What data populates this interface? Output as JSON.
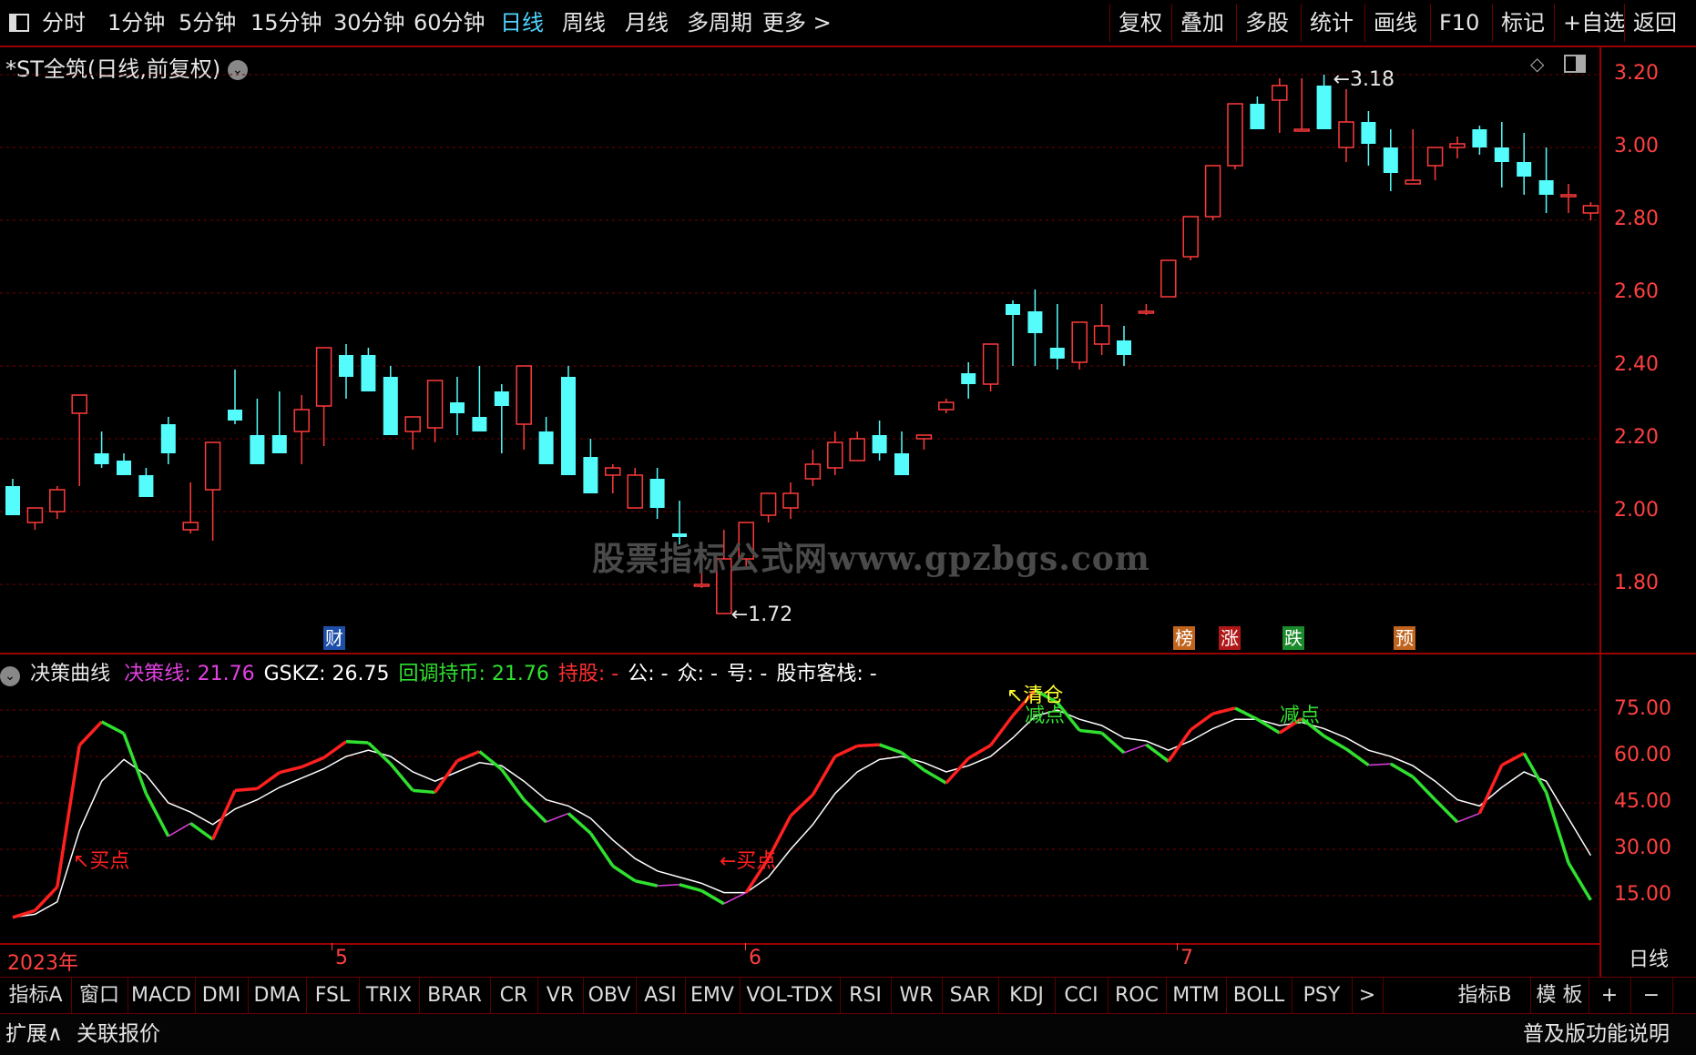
{
  "topbar": {
    "icon": "panel-toggle-icon",
    "periods": [
      "分时",
      "1分钟",
      "5分钟",
      "15分钟",
      "30分钟",
      "60分钟",
      "日线",
      "周线",
      "月线",
      "多周期",
      "更多 >"
    ],
    "selected": "日线",
    "tools": [
      "复权",
      "叠加",
      "多股",
      "统计",
      "画线",
      "F10",
      "标记",
      "+自选",
      "返回"
    ]
  },
  "main_chart": {
    "title": "*ST全筑(日线,前复权)",
    "high_label": "3.18",
    "low_label": "1.72",
    "watermark": "股票指标公式网www.gpzbgs.com",
    "y_ticks": [
      "3.20",
      "3.00",
      "2.80",
      "2.60",
      "2.40",
      "2.20",
      "2.00",
      "1.80"
    ],
    "event_tags": [
      {
        "text": "财",
        "color": "#1e4fa8"
      },
      {
        "text": "榜",
        "color": "#c0641e"
      },
      {
        "text": "涨",
        "color": "#b01818"
      },
      {
        "text": "跌",
        "color": "#1a8a2a"
      },
      {
        "text": "预",
        "color": "#c0641e"
      }
    ]
  },
  "indicator": {
    "name": "决策曲线",
    "legend": [
      {
        "label": "决策线: 21.76",
        "color": "#e040e0"
      },
      {
        "label": "GSKZ: 26.75",
        "color": "#ffffff"
      },
      {
        "label": "回调持币: 21.76",
        "color": "#30e030"
      },
      {
        "label": "持股: -",
        "color": "#ff3030"
      },
      {
        "label": "公: -",
        "color": "#ffffff"
      },
      {
        "label": "众: -",
        "color": "#ffffff"
      },
      {
        "label": "号: -",
        "color": "#ffffff"
      },
      {
        "label": "股市客栈: -",
        "color": "#ffffff"
      }
    ],
    "y_ticks": [
      "75.00",
      "60.00",
      "45.00",
      "30.00",
      "15.00"
    ],
    "signals": {
      "buy1": "↖买点",
      "buy2": "←买点",
      "clear": "↖清仓",
      "reduce1": "减点",
      "reduce2": "减点"
    }
  },
  "x_axis": {
    "labels": [
      "2023年",
      "5",
      "6",
      "7"
    ],
    "period": "日线"
  },
  "chart_data": {
    "type": "candlestick",
    "ohlc_open": [
      2.07,
      1.97,
      2.0,
      2.27,
      2.16,
      2.14,
      2.1,
      2.24,
      1.95,
      2.06,
      2.28,
      2.21,
      2.21,
      2.22,
      2.29,
      2.43,
      2.43,
      2.37,
      2.22,
      2.23,
      2.3,
      2.26,
      2.33,
      2.24,
      2.22,
      2.37,
      2.15,
      2.1,
      2.01,
      2.09,
      1.94,
      1.8,
      1.72,
      1.87,
      1.99,
      2.01,
      2.09,
      2.12,
      2.14,
      2.21,
      2.16,
      2.2,
      2.28,
      2.38,
      2.35,
      2.57,
      2.55,
      2.45,
      2.41,
      2.46,
      2.47,
      2.55,
      2.59,
      2.7,
      2.81,
      2.95,
      3.12,
      3.13,
      3.05,
      3.17,
      3.0,
      3.07,
      3.0,
      2.9,
      2.95,
      3.0,
      3.05,
      3.0,
      2.96,
      2.91,
      2.87,
      2.82
    ],
    "ohlc_high": [
      2.09,
      2.0,
      2.07,
      2.28,
      2.22,
      2.16,
      2.12,
      2.26,
      2.08,
      2.17,
      2.39,
      2.31,
      2.33,
      2.32,
      2.37,
      2.46,
      2.45,
      2.4,
      2.25,
      2.27,
      2.37,
      2.4,
      2.35,
      2.35,
      2.26,
      2.4,
      2.2,
      2.13,
      2.12,
      2.12,
      2.03,
      1.83,
      1.95,
      1.91,
      2.05,
      2.08,
      2.17,
      2.22,
      2.22,
      2.25,
      2.22,
      2.21,
      2.31,
      2.41,
      2.46,
      2.58,
      2.61,
      2.57,
      2.51,
      2.57,
      2.51,
      2.57,
      2.6,
      2.71,
      2.82,
      2.97,
      3.14,
      3.19,
      3.19,
      3.2,
      3.16,
      3.1,
      3.05,
      3.05,
      3.0,
      3.03,
      3.06,
      3.07,
      3.04,
      3.0,
      2.9,
      2.85
    ],
    "ohlc_low": [
      2.04,
      1.95,
      1.98,
      2.07,
      2.12,
      2.12,
      2.04,
      2.13,
      1.94,
      1.92,
      2.24,
      2.17,
      2.17,
      2.13,
      2.18,
      2.31,
      2.42,
      2.32,
      2.17,
      2.19,
      2.21,
      2.25,
      2.16,
      2.17,
      2.13,
      2.16,
      2.11,
      2.05,
      2.01,
      1.98,
      1.91,
      1.79,
      1.72,
      1.85,
      1.97,
      1.98,
      2.07,
      2.1,
      2.14,
      2.14,
      2.15,
      2.17,
      2.27,
      2.31,
      2.33,
      2.4,
      2.4,
      2.39,
      2.39,
      2.43,
      2.4,
      2.54,
      2.59,
      2.69,
      2.8,
      2.94,
      3.07,
      3.04,
      3.05,
      3.05,
      2.96,
      2.95,
      2.88,
      2.9,
      2.91,
      2.97,
      2.98,
      2.89,
      2.87,
      2.82,
      2.82,
      2.8
    ],
    "ohlc_close": [
      1.99,
      2.01,
      2.06,
      2.32,
      2.13,
      2.1,
      2.04,
      2.16,
      1.97,
      2.19,
      2.25,
      2.13,
      2.16,
      2.28,
      2.45,
      2.37,
      2.33,
      2.21,
      2.26,
      2.36,
      2.27,
      2.22,
      2.29,
      2.4,
      2.13,
      2.1,
      2.05,
      2.12,
      2.1,
      2.01,
      1.93,
      1.8,
      1.87,
      1.97,
      2.05,
      2.05,
      2.13,
      2.19,
      2.2,
      2.16,
      2.1,
      2.21,
      2.3,
      2.35,
      2.46,
      2.54,
      2.49,
      2.42,
      2.52,
      2.51,
      2.43,
      2.55,
      2.69,
      2.81,
      2.95,
      3.12,
      3.05,
      3.17,
      3.05,
      3.05,
      3.07,
      3.01,
      2.93,
      2.91,
      3.0,
      3.01,
      3.0,
      2.96,
      2.92,
      2.87,
      2.87,
      2.84
    ],
    "indicator_white": [
      8,
      9,
      13,
      36,
      52,
      59,
      54,
      45,
      42,
      38,
      43,
      46,
      50,
      53,
      56,
      60,
      62,
      60,
      55,
      52,
      55,
      58,
      57,
      52,
      46,
      44,
      40,
      33,
      27,
      23,
      21,
      19,
      16,
      16,
      21,
      30,
      38,
      48,
      55,
      59,
      60,
      58,
      55,
      57,
      60,
      66,
      73,
      75,
      72,
      70,
      66,
      65,
      62,
      65,
      69,
      72,
      72,
      70,
      71,
      69,
      66,
      62,
      60,
      57,
      52,
      46,
      44,
      50,
      55,
      52,
      40,
      28
    ]
  }
}
